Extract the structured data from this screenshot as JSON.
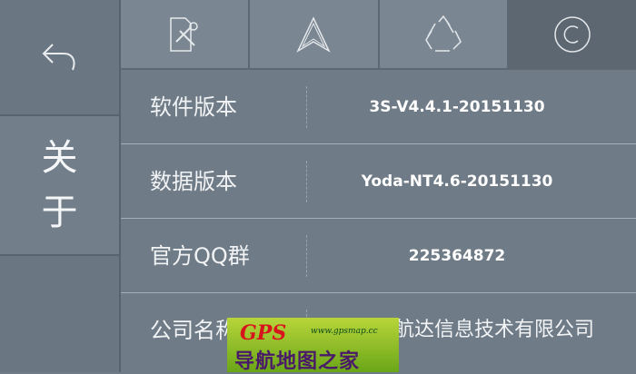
{
  "sidebar": {
    "back_icon": "back-arrow-icon",
    "active_section": [
      "关",
      "于"
    ]
  },
  "tabs": [
    {
      "icon": "settings-tools-icon"
    },
    {
      "icon": "navigation-arrow-icon"
    },
    {
      "icon": "recycle-icon"
    },
    {
      "icon": "copyright-icon",
      "active": true
    }
  ],
  "rows": [
    {
      "label": "软件版本",
      "value": "3S-V4.4.1-20151130"
    },
    {
      "label": "数据版本",
      "value": "Yoda-NT4.6-20151130"
    },
    {
      "label": "官方QQ群",
      "value": "225364872"
    },
    {
      "label": "公司名称",
      "value": "深圳顺航达信息技术有限公司"
    }
  ],
  "watermark": {
    "brand": "GPS",
    "site": "www.gpsmap.cc",
    "text": "导航地图之家"
  },
  "colors": {
    "background": "#6f7b86",
    "active_tab": "#5c6772",
    "text": "#f1f3f5"
  }
}
